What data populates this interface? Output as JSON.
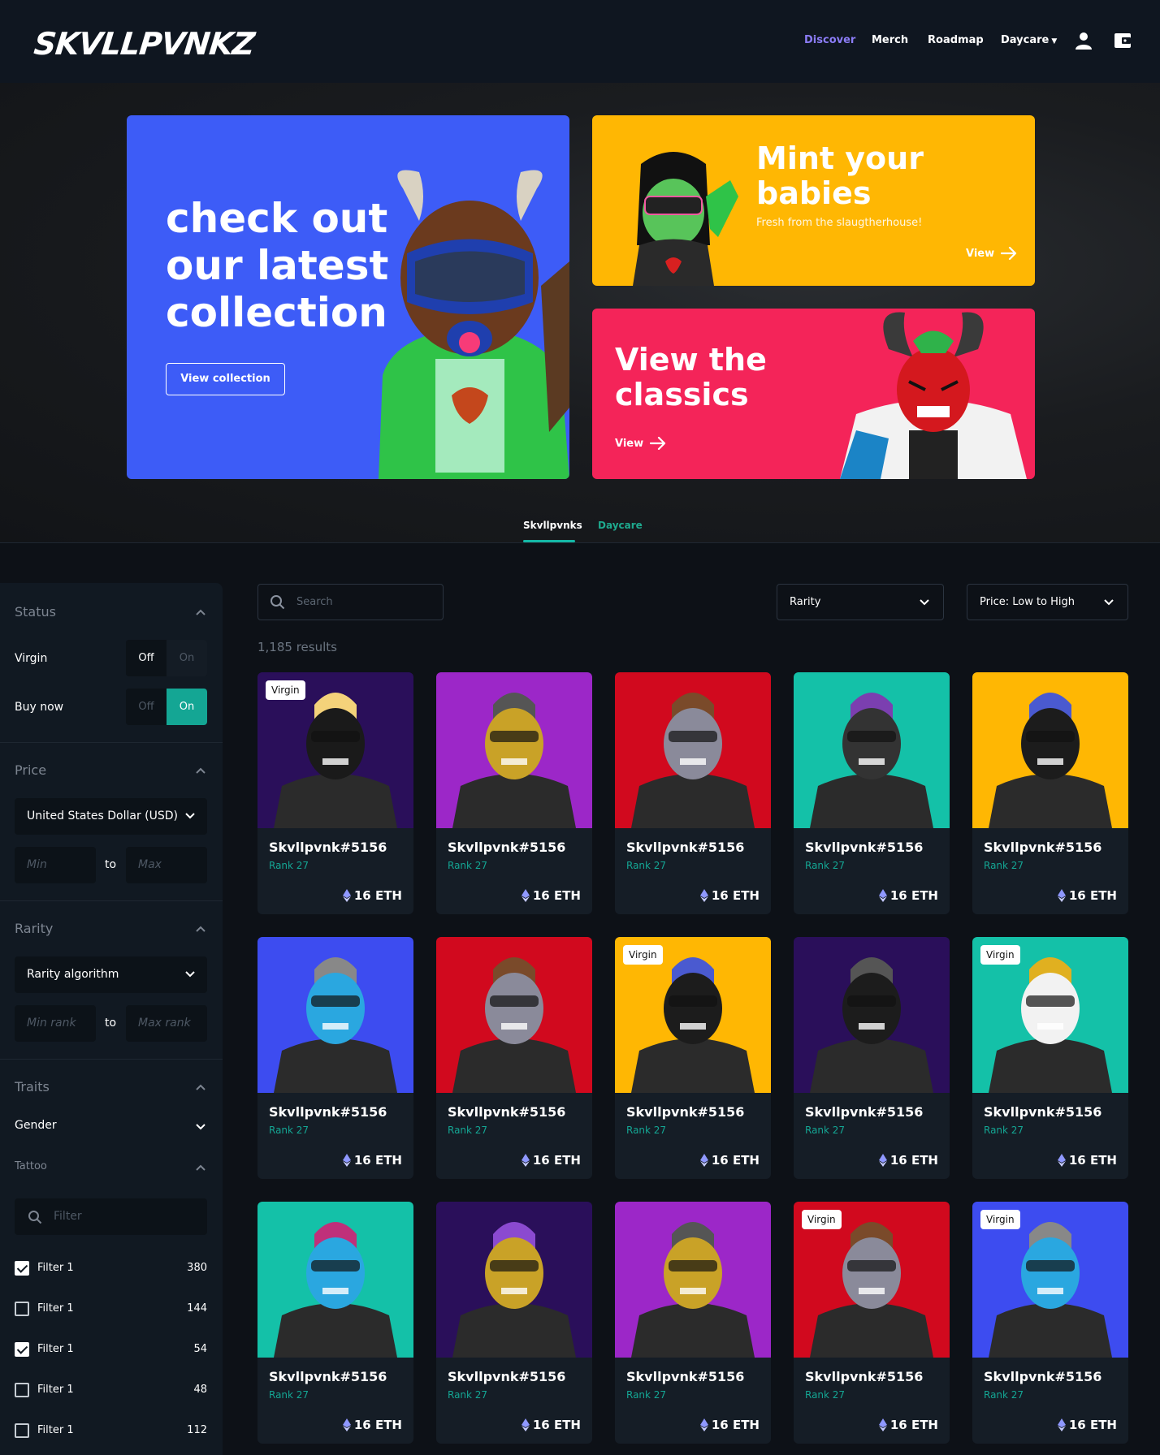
{
  "header": {
    "logo": "SKVLLPVNKZ",
    "nav": [
      {
        "label": "Discover",
        "active": true
      },
      {
        "label": "Merch"
      },
      {
        "label": "Roadmap"
      },
      {
        "label": "Daycare"
      }
    ],
    "icons": [
      "user-icon",
      "wallet-icon"
    ]
  },
  "hero": {
    "main": {
      "title": "check out our latest collection",
      "button": "View collection"
    },
    "mint": {
      "title": "Mint your babies",
      "subtitle": "Fresh from the slaugtherhouse!",
      "link": "View"
    },
    "classics": {
      "title": "View the classics",
      "link": "View"
    }
  },
  "tabs": [
    "Skvllpvnks",
    "Daycare"
  ],
  "sidebar": {
    "status": {
      "title": "Status",
      "rows": [
        {
          "label": "Virgin",
          "off": "Off",
          "on": "On",
          "value": "Off"
        },
        {
          "label": "Buy now",
          "off": "Off",
          "on": "On",
          "value": "On"
        }
      ]
    },
    "price": {
      "title": "Price",
      "currency": "United States Dollar (USD)",
      "min": "Min",
      "to": "to",
      "max": "Max"
    },
    "rarity": {
      "title": "Rarity",
      "algorithm": "Rarity algorithm",
      "min": "Min rank",
      "to": "to",
      "max": "Max rank"
    },
    "traits": {
      "title": "Traits",
      "gender": "Gender",
      "tattoo": "Tattoo",
      "filter_placeholder": "Filter",
      "filters": [
        {
          "label": "Filter 1",
          "count": "380",
          "checked": true
        },
        {
          "label": "Filter 1",
          "count": "144",
          "checked": false
        },
        {
          "label": "Filter 1",
          "count": "54",
          "checked": true
        },
        {
          "label": "Filter 1",
          "count": "48",
          "checked": false
        },
        {
          "label": "Filter 1",
          "count": "112",
          "checked": false
        }
      ]
    }
  },
  "toolbar": {
    "search_placeholder": "Search",
    "rarity": "Rarity",
    "sort": "Price: Low to High",
    "results": "1,185 results"
  },
  "nfts": [
    {
      "name": "Skvllpvnk#5156",
      "rank": "Rank 27",
      "price": "16 ETH",
      "badge": "Virgin",
      "bg": "#2a0f5a",
      "mask": "#1a1a1a",
      "hair": "#f4d27a"
    },
    {
      "name": "Skvllpvnk#5156",
      "rank": "Rank 27",
      "price": "16 ETH",
      "badge": "",
      "bg": "#9c27c8",
      "mask": "#c9a227",
      "hair": "#555"
    },
    {
      "name": "Skvllpvnk#5156",
      "rank": "Rank 27",
      "price": "16 ETH",
      "badge": "",
      "bg": "#d1091e",
      "mask": "#8a8a9a",
      "hair": "#7a4a2a"
    },
    {
      "name": "Skvllpvnk#5156",
      "rank": "Rank 27",
      "price": "16 ETH",
      "badge": "",
      "bg": "#14c1a8",
      "mask": "#333",
      "hair": "#7b3fb0"
    },
    {
      "name": "Skvllpvnk#5156",
      "rank": "Rank 27",
      "price": "16 ETH",
      "badge": "",
      "bg": "#ffb703",
      "mask": "#1c1c1c",
      "hair": "#4a5ad0"
    },
    {
      "name": "Skvllpvnk#5156",
      "rank": "Rank 27",
      "price": "16 ETH",
      "badge": "",
      "bg": "#3d4cf0",
      "mask": "#2aa7e0",
      "hair": "#888"
    },
    {
      "name": "Skvllpvnk#5156",
      "rank": "Rank 27",
      "price": "16 ETH",
      "badge": "",
      "bg": "#d1091e",
      "mask": "#8a8a9a",
      "hair": "#7a4a2a"
    },
    {
      "name": "Skvllpvnk#5156",
      "rank": "Rank 27",
      "price": "16 ETH",
      "badge": "Virgin",
      "bg": "#ffb703",
      "mask": "#1c1c1c",
      "hair": "#4a5ad0"
    },
    {
      "name": "Skvllpvnk#5156",
      "rank": "Rank 27",
      "price": "16 ETH",
      "badge": "",
      "bg": "#2a0f5a",
      "mask": "#1c1c1c",
      "hair": "#555"
    },
    {
      "name": "Skvllpvnk#5156",
      "rank": "Rank 27",
      "price": "16 ETH",
      "badge": "Virgin",
      "bg": "#14c1a8",
      "mask": "#f2f2f2",
      "hair": "#e0b020"
    },
    {
      "name": "Skvllpvnk#5156",
      "rank": "Rank 27",
      "price": "16 ETH",
      "badge": "",
      "bg": "#14c1a8",
      "mask": "#2aa7e0",
      "hair": "#c0307a"
    },
    {
      "name": "Skvllpvnk#5156",
      "rank": "Rank 27",
      "price": "16 ETH",
      "badge": "",
      "bg": "#2a0f5a",
      "mask": "#c9a227",
      "hair": "#8b4ad0"
    },
    {
      "name": "Skvllpvnk#5156",
      "rank": "Rank 27",
      "price": "16 ETH",
      "badge": "",
      "bg": "#9c27c8",
      "mask": "#c9a227",
      "hair": "#555"
    },
    {
      "name": "Skvllpvnk#5156",
      "rank": "Rank 27",
      "price": "16 ETH",
      "badge": "Virgin",
      "bg": "#d1091e",
      "mask": "#8a8a9a",
      "hair": "#7a4a2a"
    },
    {
      "name": "Skvllpvnk#5156",
      "rank": "Rank 27",
      "price": "16 ETH",
      "badge": "Virgin",
      "bg": "#3d4cf0",
      "mask": "#2aa7e0",
      "hair": "#888"
    }
  ]
}
